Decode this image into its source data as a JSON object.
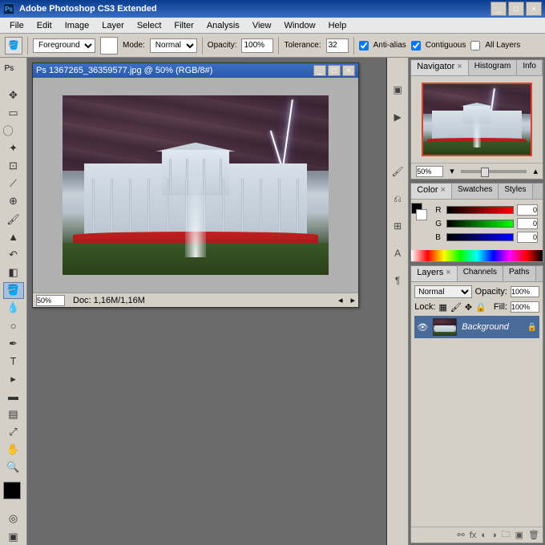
{
  "app": {
    "title": "Adobe Photoshop CS3 Extended"
  },
  "menu": [
    "File",
    "Edit",
    "Image",
    "Layer",
    "Select",
    "Filter",
    "Analysis",
    "View",
    "Window",
    "Help"
  ],
  "options": {
    "fill_label": "Foreground",
    "mode_label": "Mode:",
    "mode_value": "Normal",
    "opacity_label": "Opacity:",
    "opacity_value": "100%",
    "tolerance_label": "Tolerance:",
    "tolerance_value": "32",
    "antialias": "Anti-alias",
    "contiguous": "Contiguous",
    "all_layers": "All Layers"
  },
  "document": {
    "title": "1367265_36359577.jpg @ 50% (RGB/8#)",
    "zoom": "50%",
    "doc_size": "Doc: 1,16M/1,16M"
  },
  "navigator": {
    "tabs": [
      "Navigator",
      "Histogram",
      "Info"
    ],
    "zoom": "50%"
  },
  "color": {
    "tabs": [
      "Color",
      "Swatches",
      "Styles"
    ],
    "channels": [
      {
        "label": "R",
        "value": "0"
      },
      {
        "label": "G",
        "value": "0"
      },
      {
        "label": "B",
        "value": "0"
      }
    ]
  },
  "layers": {
    "tabs": [
      "Layers",
      "Channels",
      "Paths"
    ],
    "blend_mode": "Normal",
    "opacity_label": "Opacity:",
    "opacity_value": "100%",
    "lock_label": "Lock:",
    "fill_label": "Fill:",
    "fill_value": "100%",
    "items": [
      {
        "name": "Background",
        "visible": true,
        "locked": true
      }
    ]
  }
}
